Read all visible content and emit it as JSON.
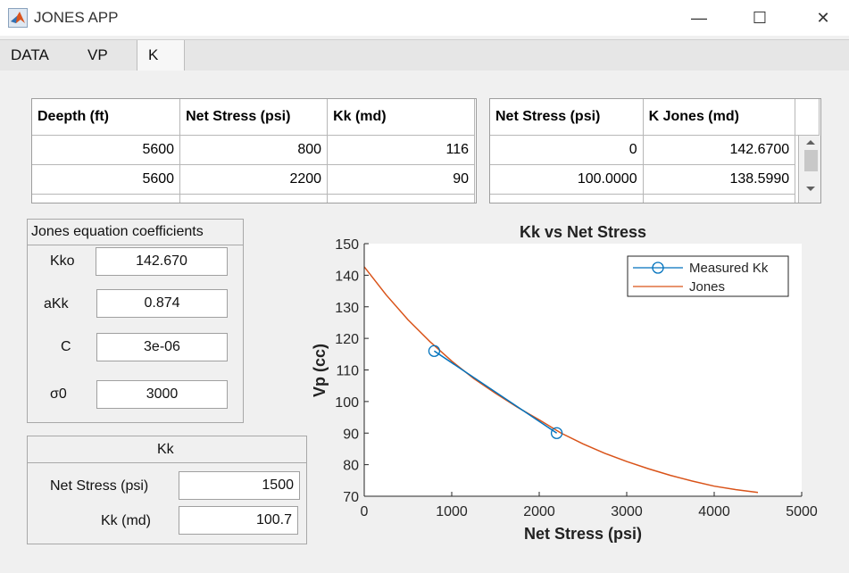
{
  "window": {
    "title": "JONES APP",
    "minimize_glyph": "—",
    "maximize_glyph": "☐",
    "close_glyph": "✕",
    "icon": "matlab-logo-icon"
  },
  "tabs": [
    {
      "label": "DATA",
      "active": false
    },
    {
      "label": "VP",
      "active": false
    },
    {
      "label": "K",
      "active": true
    }
  ],
  "measured_table": {
    "headers": [
      "Deepth (ft)",
      "Net Stress (psi)",
      "Kk (md)"
    ],
    "rows": [
      [
        "5600",
        "800",
        "116"
      ],
      [
        "5600",
        "2200",
        "90"
      ]
    ]
  },
  "jones_table": {
    "headers": [
      "Net Stress (psi)",
      "K Jones (md)"
    ],
    "rows": [
      [
        "0",
        "142.6700"
      ],
      [
        "100.0000",
        "138.5990"
      ]
    ]
  },
  "coefficients": {
    "title": "Jones equation coefficients",
    "kko_label": "Kko",
    "kko_value": "142.670",
    "akk_label": "aKk",
    "akk_value": "0.874",
    "c_label": "C",
    "c_value": "3e-06",
    "sigma_label": "σ0",
    "sigma_value": "3000"
  },
  "kk_panel": {
    "title": "Kk",
    "net_stress_label": "Net Stress (psi)",
    "net_stress_value": "1500",
    "kk_label": "Kk (md)",
    "kk_value": "100.7"
  },
  "chart_data": {
    "type": "line",
    "title": "Kk vs Net Stress",
    "xlabel": "Net Stress (psi)",
    "ylabel": "Vp (cc)",
    "xlim": [
      0,
      5000
    ],
    "ylim": [
      70,
      150
    ],
    "xticks": [
      0,
      1000,
      2000,
      3000,
      4000,
      5000
    ],
    "yticks": [
      70,
      80,
      90,
      100,
      110,
      120,
      130,
      140,
      150
    ],
    "legend_position": "top-right",
    "series": [
      {
        "name": "Measured Kk",
        "color": "#0072bd",
        "marker": "circle",
        "x": [
          800,
          2200
        ],
        "y": [
          116,
          90
        ]
      },
      {
        "name": "Jones",
        "color": "#d95319",
        "marker": "none",
        "x": [
          0,
          250,
          500,
          750,
          1000,
          1250,
          1500,
          1750,
          2000,
          2250,
          2500,
          2750,
          3000,
          3250,
          3500,
          3750,
          4000,
          4250,
          4500
        ],
        "y": [
          142.67,
          133.8,
          125.9,
          119.0,
          112.8,
          107.3,
          102.6,
          98.2,
          94.2,
          90.0,
          86.6,
          83.6,
          81.0,
          78.7,
          76.6,
          74.8,
          73.2,
          72.1,
          71.2
        ]
      }
    ]
  }
}
